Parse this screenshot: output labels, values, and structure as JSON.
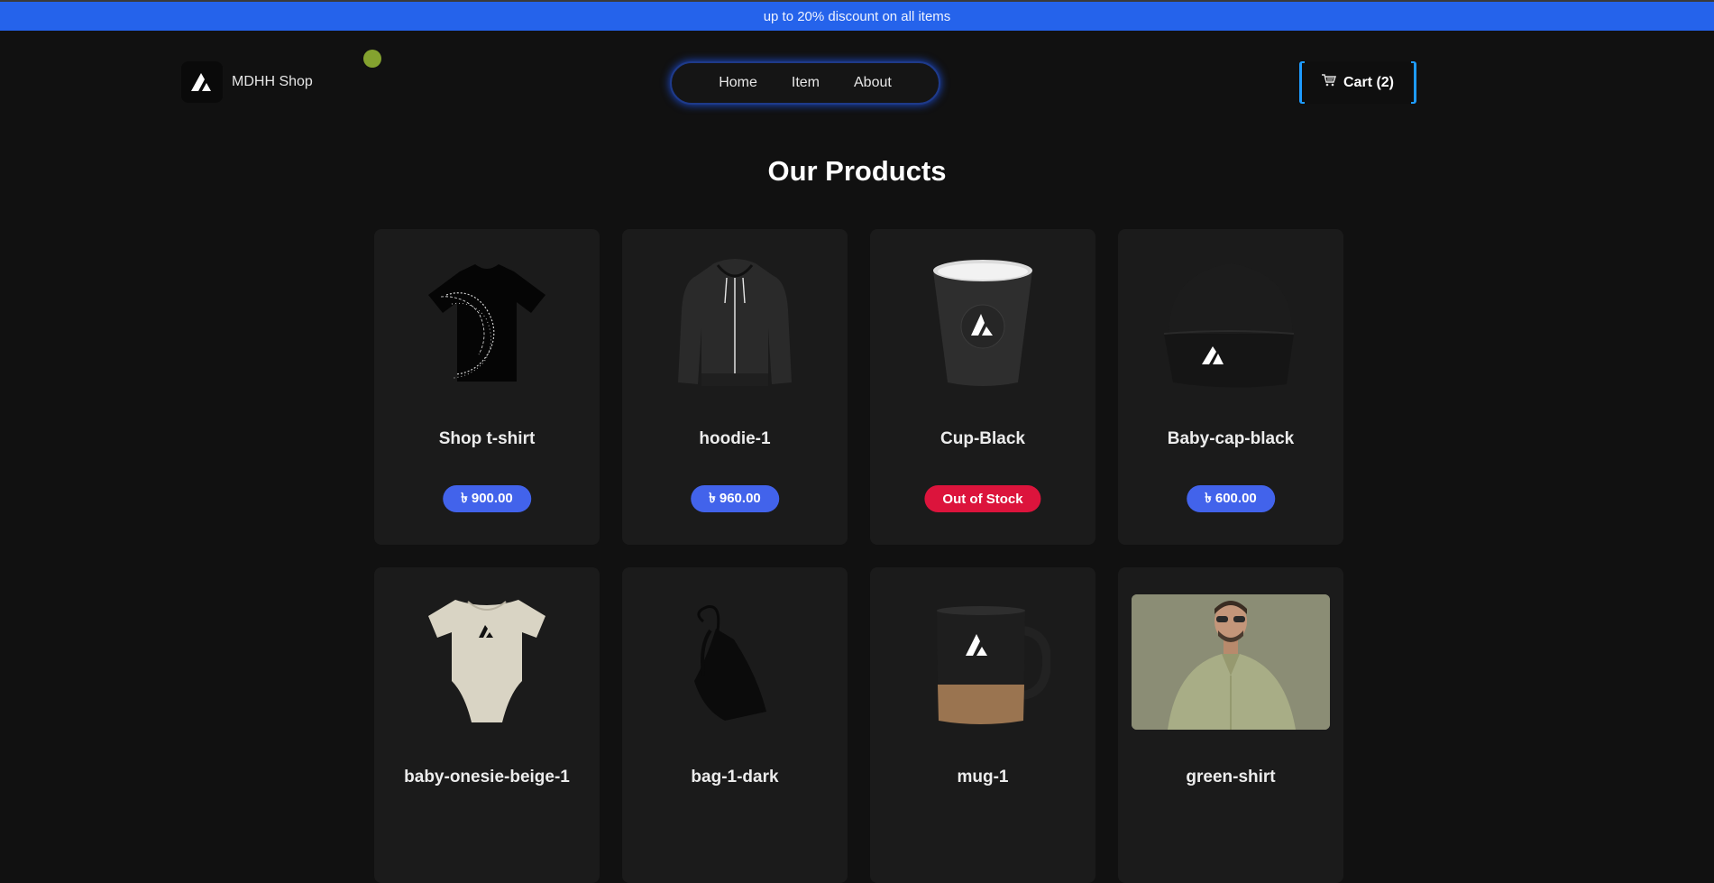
{
  "banner": {
    "text": "up to 20% discount on all items"
  },
  "brand": {
    "name": "MDHH Shop",
    "logo_icon": "triangle-logo-icon"
  },
  "nav": {
    "items": [
      {
        "label": "Home"
      },
      {
        "label": "Item"
      },
      {
        "label": "About"
      }
    ]
  },
  "cart": {
    "label": "Cart (2)",
    "icon": "cart-icon"
  },
  "page": {
    "title": "Our Products"
  },
  "colors": {
    "banner": "#2563eb",
    "price_badge": "#4263eb",
    "out_of_stock": "#dc143c",
    "background": "#111111",
    "card": "#1b1b1b",
    "status_dot": "#84a22f"
  },
  "products": [
    {
      "name": "Shop t-shirt",
      "price": "৳ 900.00",
      "image": "t-shirt-image"
    },
    {
      "name": "hoodie-1",
      "price": "৳ 960.00",
      "image": "hoodie-image"
    },
    {
      "name": "Cup-Black",
      "price": "Out of Stock",
      "image": "cup-image"
    },
    {
      "name": "Baby-cap-black",
      "price": "৳ 600.00",
      "image": "beanie-image"
    },
    {
      "name": "baby-onesie-beige-1",
      "image": "onesie-image"
    },
    {
      "name": "bag-1-dark",
      "image": "bag-image"
    },
    {
      "name": "mug-1",
      "image": "mug-image"
    },
    {
      "name": "green-shirt",
      "image": "green-shirt-image"
    }
  ]
}
